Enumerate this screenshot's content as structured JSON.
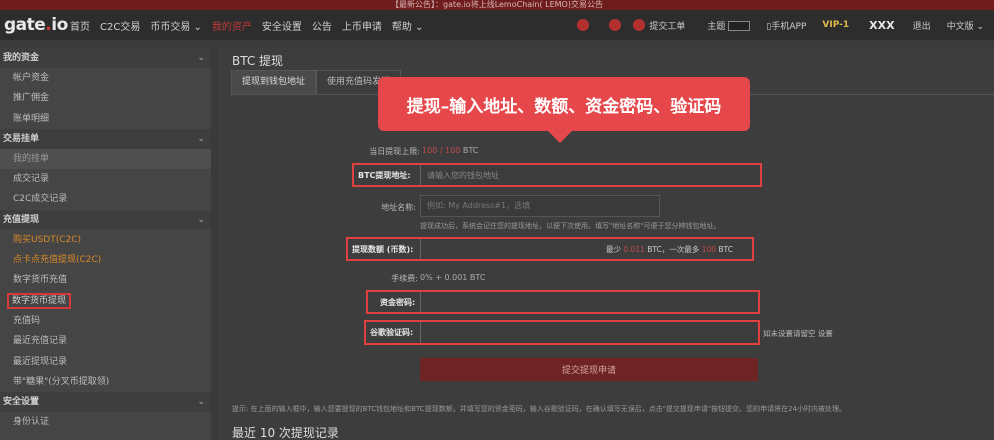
{
  "announcement": "【最新公告】：gate.io将上线LemoChain( LEMO)交易公告",
  "nav": {
    "logo_text": "gate",
    "logo_dot": ".",
    "logo_suffix": "io",
    "items": [
      "首页",
      "C2C交易",
      "币币交易 ⌄",
      "我的资产",
      "安全设置",
      "公告",
      "上币申请",
      "帮助 ⌄"
    ],
    "ticket": "提交工单",
    "theme_label": "主题",
    "mobile_app": "▯手机APP",
    "vip": "VIP-1",
    "user": "XXX",
    "logout": "退出",
    "lang": "中文版 ⌄"
  },
  "sidebar": {
    "sections": [
      {
        "title": "我的资金",
        "items": [
          "帐户资金",
          "推广佣金",
          "账单明细"
        ]
      },
      {
        "title": "交易挂单",
        "items": [
          "我的挂单",
          "成交记录",
          "C2C成交记录"
        ]
      },
      {
        "title": "充值提现",
        "items": [
          "购买USDT(C2C)",
          "点卡点充值提现(C2C)",
          "数字货币充值",
          "数字货币提现",
          "充值码",
          "最近充值记录",
          "最近提现记录",
          "带\"糖果\"(分叉币提取领)"
        ]
      },
      {
        "title": "安全设置",
        "items": [
          "身份认证"
        ]
      }
    ]
  },
  "main": {
    "title": "BTC 提现",
    "tabs": [
      "提现到钱包地址",
      "使用充值码发送"
    ],
    "callout": "提现–输入地址、数额、资金密码、验证码",
    "daily_limit_label": "当日提现上限:",
    "daily_limit_used": "100 / 100",
    "daily_limit_unit": " BTC",
    "address_label": "BTC提现地址:",
    "address_placeholder": "请输入您的钱包地址",
    "addr_name_label": "地址名称:",
    "addr_name_placeholder": "例如: My Address#1，选填",
    "addr_hint": "提现成功后，系统会记住您的提现地址，以便下次使用。填写\"地址名称\"可便于您分辨钱包地址。",
    "amount_label": "提现数额 (币数):",
    "amount_hint_pre": "最少",
    "amount_min": "0.011",
    "amount_hint_mid": "BTC，一次最多",
    "amount_max": "100",
    "amount_hint_post": "BTC",
    "fee_label": "手续费:",
    "fee_value": "0% + 0.001 BTC",
    "fund_pw_label": "资金密码:",
    "verify_label": "谷歌验证码:",
    "verify_hint": "如未设置请留空 设置",
    "submit": "提交提现申请",
    "note": "提示: 在上面的输入框中，输入您要提现的BTC钱包地址和BTC提现数额，并填写您的资金密码，输入谷歌验证码，在确认填写无误后，点击\"提交提现申请\"按钮提交。您的申请将在24小时内被处理。",
    "recent_title": "最近 10 次提现记录"
  }
}
